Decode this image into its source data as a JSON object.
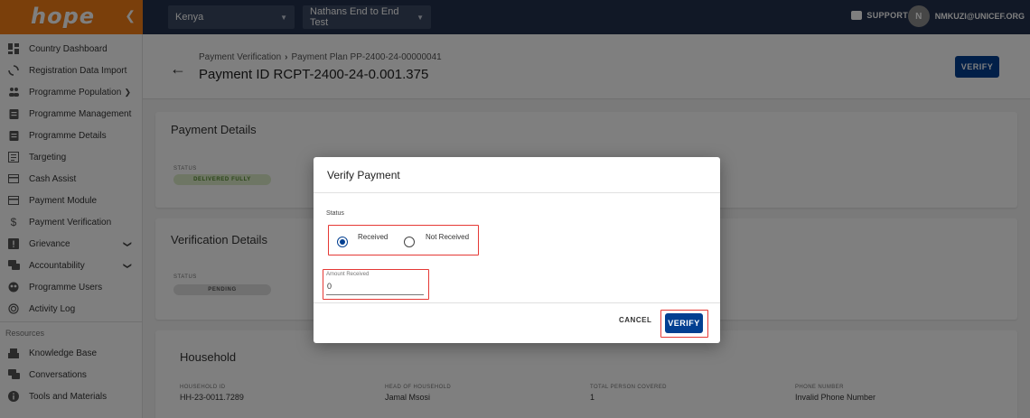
{
  "topbar": {
    "logo": "hope",
    "country": "Kenya",
    "program": "Nathans End to End Test",
    "support": "SUPPORT",
    "avatar_initial": "N",
    "user_email": "NMKUZI@UNICEF.ORG"
  },
  "sidebar": {
    "items": [
      {
        "label": "Country Dashboard",
        "icon": "dashboard-icon"
      },
      {
        "label": "Registration Data Import",
        "icon": "sync-icon"
      },
      {
        "label": "Programme Population",
        "icon": "people-icon",
        "expandable": true
      },
      {
        "label": "Programme Management",
        "icon": "clipboard-icon"
      },
      {
        "label": "Programme Details",
        "icon": "clipboard-icon"
      },
      {
        "label": "Targeting",
        "icon": "list-icon"
      },
      {
        "label": "Cash Assist",
        "icon": "card-icon"
      },
      {
        "label": "Payment Module",
        "icon": "card-icon"
      },
      {
        "label": "Payment Verification",
        "icon": "dollar-icon"
      },
      {
        "label": "Grievance",
        "icon": "grievance-icon",
        "expandable": true
      },
      {
        "label": "Accountability",
        "icon": "forum-icon",
        "expandable": true
      },
      {
        "label": "Programme Users",
        "icon": "users-icon"
      },
      {
        "label": "Activity Log",
        "icon": "fingerprint-icon"
      }
    ],
    "resources_label": "Resources",
    "resources": [
      {
        "label": "Knowledge Base",
        "icon": "book-icon"
      },
      {
        "label": "Conversations",
        "icon": "forum-icon"
      },
      {
        "label": "Tools and Materials",
        "icon": "info-icon"
      }
    ]
  },
  "header": {
    "breadcrumb_parent": "Payment Verification",
    "breadcrumb_child": "Payment Plan PP-2400-24-00000041",
    "title": "Payment ID RCPT-2400-24-0.001.375",
    "verify_label": "VERIFY"
  },
  "payment_details": {
    "title": "Payment Details",
    "status_label": "STATUS",
    "status_value": "DELIVERED FULLY"
  },
  "verification_details": {
    "title": "Verification Details",
    "status_label": "STATUS",
    "status_value": "PENDING"
  },
  "household": {
    "title": "Household",
    "fields": [
      {
        "key": "HOUSEHOLD ID",
        "value": "HH-23-0011.7289"
      },
      {
        "key": "HEAD OF HOUSEHOLD",
        "value": "Jamal Msosi"
      },
      {
        "key": "TOTAL PERSON COVERED",
        "value": "1"
      },
      {
        "key": "PHONE NUMBER",
        "value": "Invalid Phone Number"
      }
    ]
  },
  "modal": {
    "title": "Verify Payment",
    "status_label": "Status",
    "options": [
      "Received",
      "Not Received"
    ],
    "selected": "Received",
    "amount_label": "Amount Received",
    "amount_value": "0",
    "cancel_label": "CANCEL",
    "verify_label": "VERIFY"
  },
  "colors": {
    "brand_orange": "#f57f17",
    "appbar_navy": "#22304c",
    "primary_blue": "#033f91",
    "highlight_red": "#e53935",
    "success_green": "#dcedc8"
  }
}
